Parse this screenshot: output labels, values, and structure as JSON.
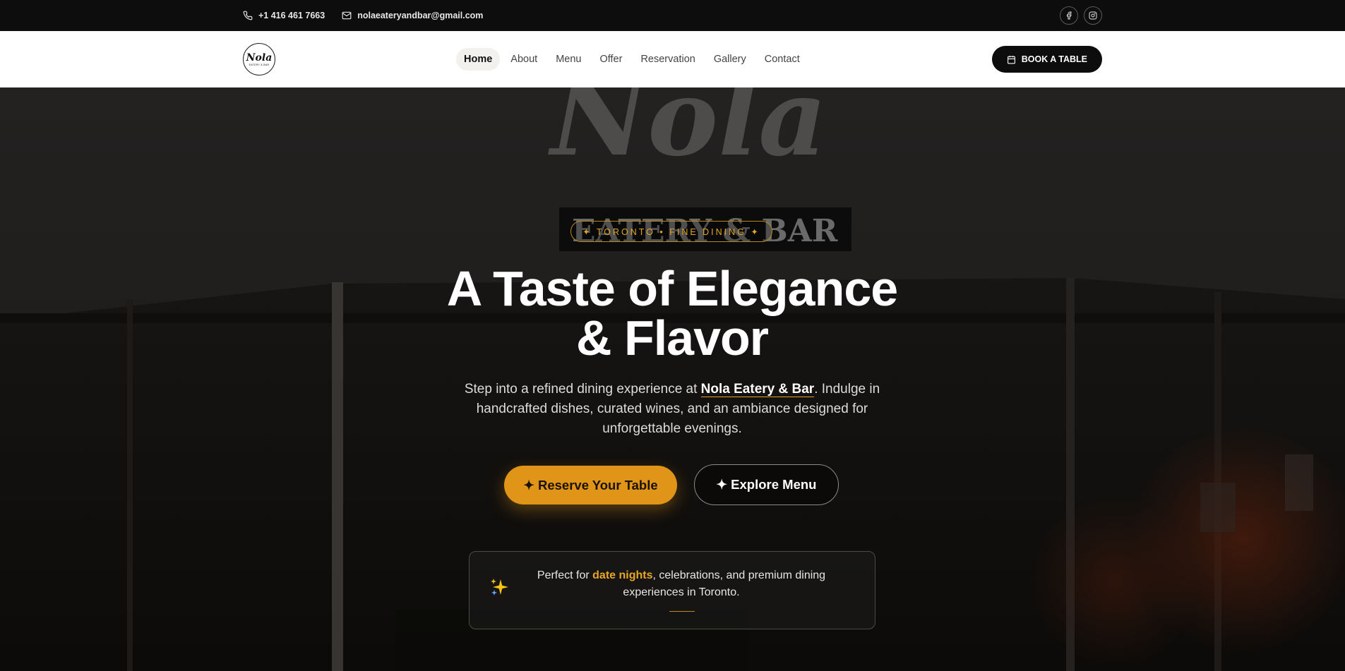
{
  "topbar": {
    "phone": "+1 416 461 7663",
    "email": "nolaeateryandbar@gmail.com",
    "socials": [
      {
        "name": "facebook",
        "icon": "facebook-icon"
      },
      {
        "name": "instagram",
        "icon": "instagram-icon"
      }
    ]
  },
  "nav": {
    "logo_text": "Nola",
    "logo_sub": "EATERY & BAR",
    "items": [
      {
        "label": "Home",
        "active": true
      },
      {
        "label": "About",
        "active": false
      },
      {
        "label": "Menu",
        "active": false
      },
      {
        "label": "Offer",
        "active": false
      },
      {
        "label": "Reservation",
        "active": false
      },
      {
        "label": "Gallery",
        "active": false
      },
      {
        "label": "Contact",
        "active": false
      }
    ],
    "book_label": "BOOK A TABLE",
    "book_icon": "calendar-icon"
  },
  "hero": {
    "badge": "✦ TORONTO • FINE DINING ✦",
    "headline_line1": "A Taste of Elegance",
    "headline_line2": "& Flavor",
    "sub_before": "Step into a refined dining experience at ",
    "sub_brand": "Nola Eatery & Bar",
    "sub_after": ". Indulge in handcrafted dishes, curated wines, and an ambiance designed for unforgettable evenings.",
    "primary_button": "✦ Reserve Your Table",
    "secondary_button": "✦ Explore Menu",
    "card_before": "Perfect for ",
    "card_highlight": "date nights",
    "card_after": ", celebrations, and premium dining experiences in Toronto.",
    "card_icon": "sparkles-icon"
  },
  "colors": {
    "accent": "#e09418",
    "accent_text": "#e8a628",
    "dark": "#0d0d0d",
    "white": "#ffffff"
  }
}
